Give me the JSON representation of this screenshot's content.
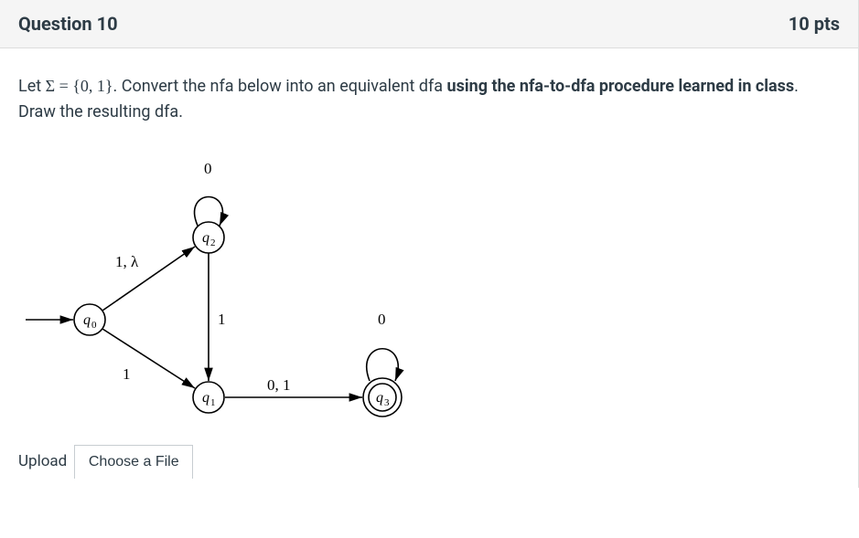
{
  "header": {
    "title": "Question 10",
    "points": "10 pts"
  },
  "prompt": {
    "prefix": "Let ",
    "equation": "Σ = {0, 1}",
    "mid": ". Convert the nfa below into an equivalent dfa ",
    "bold": "using the nfa-to-dfa procedure learned in class",
    "suffix": ". Draw the resulting dfa."
  },
  "diagram": {
    "states": {
      "q0": {
        "label_base": "q",
        "label_sub": "0",
        "initial": true,
        "accepting": false
      },
      "q1": {
        "label_base": "q",
        "label_sub": "1",
        "initial": false,
        "accepting": false
      },
      "q2": {
        "label_base": "q",
        "label_sub": "2",
        "initial": false,
        "accepting": false
      },
      "q3": {
        "label_base": "q",
        "label_sub": "3",
        "initial": false,
        "accepting": true
      }
    },
    "edges": {
      "q0_q2": "1, λ",
      "q0_q1": "1",
      "q2_q2": "0",
      "q2_q1": "1",
      "q1_q3": "0, 1",
      "q3_q3": "0"
    }
  },
  "upload": {
    "label": "Upload",
    "button": "Choose a File"
  }
}
